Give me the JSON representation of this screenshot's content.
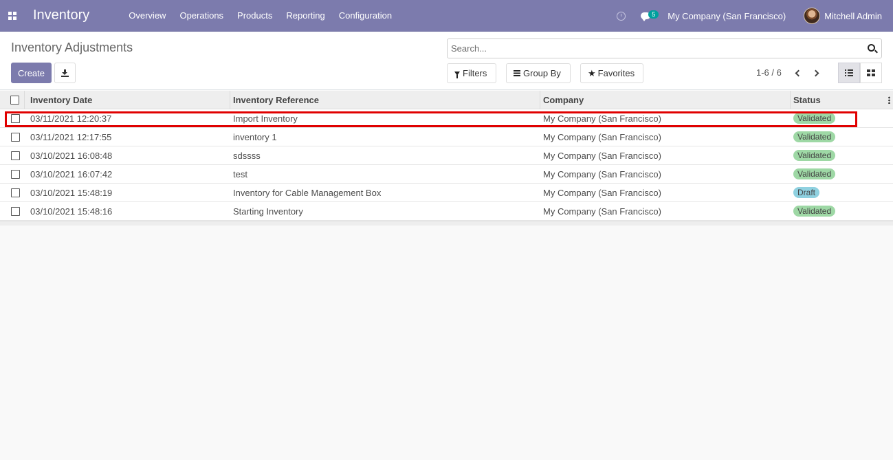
{
  "navbar": {
    "brand": "Inventory",
    "menu": [
      "Overview",
      "Operations",
      "Products",
      "Reporting",
      "Configuration"
    ],
    "chat_count": "5",
    "company": "My Company (San Francisco)",
    "user": "Mitchell Admin"
  },
  "control": {
    "breadcrumb": "Inventory Adjustments",
    "create_label": "Create",
    "search_placeholder": "Search...",
    "filters_label": "Filters",
    "groupby_label": "Group By",
    "favorites_label": "Favorites",
    "pager": "1-6 / 6"
  },
  "table": {
    "headers": {
      "date": "Inventory Date",
      "reference": "Inventory Reference",
      "company": "Company",
      "status": "Status"
    },
    "rows": [
      {
        "date": "03/11/2021 12:20:37",
        "reference": "Import Inventory",
        "company": "My Company (San Francisco)",
        "status": "Validated"
      },
      {
        "date": "03/11/2021 12:17:55",
        "reference": "inventory 1",
        "company": "My Company (San Francisco)",
        "status": "Validated"
      },
      {
        "date": "03/10/2021 16:08:48",
        "reference": "sdssss",
        "company": "My Company (San Francisco)",
        "status": "Validated"
      },
      {
        "date": "03/10/2021 16:07:42",
        "reference": "test",
        "company": "My Company (San Francisco)",
        "status": "Validated"
      },
      {
        "date": "03/10/2021 15:48:19",
        "reference": "Inventory for Cable Management Box",
        "company": "My Company (San Francisco)",
        "status": "Draft"
      },
      {
        "date": "03/10/2021 15:48:16",
        "reference": "Starting Inventory",
        "company": "My Company (San Francisco)",
        "status": "Validated"
      }
    ]
  },
  "colors": {
    "navbar": "#7c7bad",
    "validated_badge": "#9ed8a5",
    "draft_badge": "#8fd1e0",
    "highlight": "#e00000"
  }
}
